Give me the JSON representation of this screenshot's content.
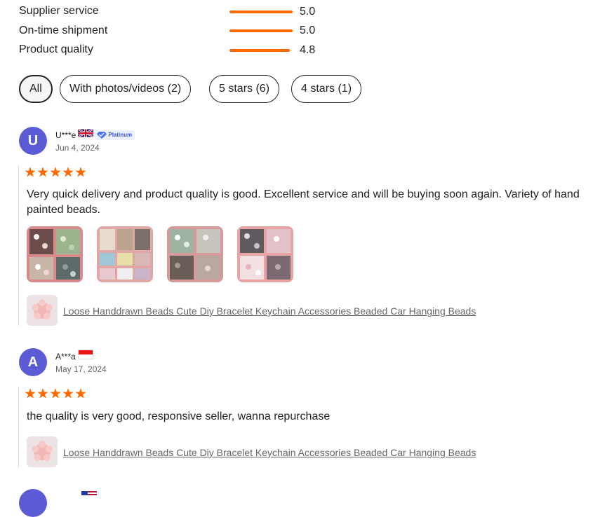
{
  "ratings": [
    {
      "label": "Supplier service",
      "value": "5.0",
      "score": 5.0
    },
    {
      "label": "On-time shipment",
      "value": "5.0",
      "score": 5.0
    },
    {
      "label": "Product quality",
      "value": "4.8",
      "score": 4.8
    }
  ],
  "filters": [
    {
      "label": "All",
      "active": true
    },
    {
      "label": "With photos/videos (2)",
      "active": false
    },
    {
      "label": "5 stars (6)",
      "active": false
    },
    {
      "label": "4 stars (1)",
      "active": false
    }
  ],
  "reviews": [
    {
      "avatar_letter": "U",
      "user": "U***e",
      "flag": "uk-flag",
      "badge": "Platinum",
      "date": "Jun 4, 2024",
      "stars": 5,
      "text": "Very quick delivery and product quality is good. Excellent service and will be buying soon again. Variety of hand painted beads.",
      "product": "Loose Handdrawn Beads Cute Diy Bracelet Keychain Accessories Beaded Car Hanging Beads"
    },
    {
      "avatar_letter": "A",
      "user": "A***a",
      "flag": "indonesia-flag",
      "date": "May 17, 2024",
      "stars": 5,
      "text": "the quality is very good, responsive seller, wanna repurchase",
      "product": "Loose Handdrawn Beads Cute Diy Bracelet Keychain Accessories Beaded Car Hanging Beads"
    }
  ],
  "colors": {
    "accent": "#ff6a00",
    "avatar": "#5b5bd6"
  }
}
